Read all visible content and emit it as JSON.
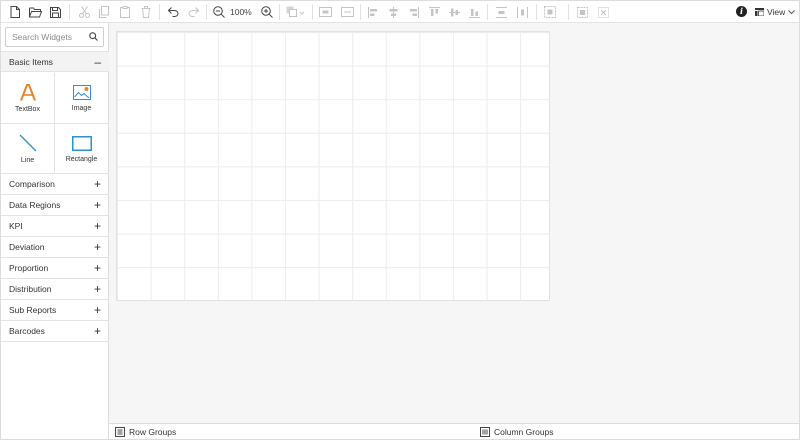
{
  "toolbar": {
    "zoom_level": "100%",
    "view_label": "View",
    "info_glyph": "i",
    "buttons": [
      "new-icon",
      "open-icon",
      "save-icon",
      "cut-icon",
      "copy-icon",
      "paste-icon",
      "delete-icon",
      "undo-icon",
      "redo-icon",
      "zoom-out-icon",
      "zoom-in-icon",
      "order-icon",
      "align-icon",
      "grid-icon",
      "info-icon",
      "view-icon"
    ]
  },
  "sidebar": {
    "search_placeholder": "Search Widgets",
    "basic": {
      "label": "Basic Items",
      "sign": "–",
      "items": [
        {
          "label": "TextBox",
          "icon": "textbox-icon"
        },
        {
          "label": "Image",
          "icon": "image-icon"
        },
        {
          "label": "Line",
          "icon": "line-icon"
        },
        {
          "label": "Rectangle",
          "icon": "rectangle-icon"
        }
      ]
    },
    "categories": [
      {
        "label": "Comparison",
        "sign": "+"
      },
      {
        "label": "Data Regions",
        "sign": "+"
      },
      {
        "label": "KPI",
        "sign": "+"
      },
      {
        "label": "Deviation",
        "sign": "+"
      },
      {
        "label": "Proportion",
        "sign": "+"
      },
      {
        "label": "Distribution",
        "sign": "+"
      },
      {
        "label": "Sub Reports",
        "sign": "+"
      },
      {
        "label": "Barcodes",
        "sign": "+"
      }
    ]
  },
  "groups": {
    "row_label": "Row Groups",
    "column_label": "Column Groups"
  },
  "colors": {
    "accent_blue": "#2f8fd1",
    "textbox_orange": "#e8832a"
  }
}
